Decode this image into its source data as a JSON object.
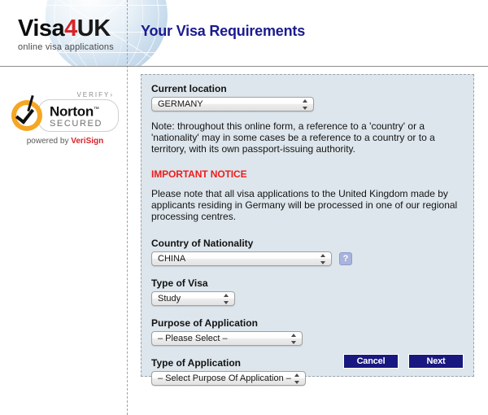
{
  "header": {
    "logo": {
      "part1": "Visa",
      "part2": "4",
      "part3": "UK",
      "tagline": "online visa applications"
    },
    "title": "Your Visa Requirements"
  },
  "security_badge": {
    "verify": "VERIFY›",
    "norton": "Norton",
    "trademark": "™",
    "secured": "SECURED",
    "powered_prefix": "powered by ",
    "powered_brand": "VeriSign"
  },
  "form": {
    "current_location": {
      "label": "Current location",
      "value": "GERMANY"
    },
    "note": "Note: throughout this online form, a reference to a 'country' or a 'nationality' may in some cases be a reference to a country or to a territory, with its own passport-issuing authority.",
    "important_notice": {
      "title": "IMPORTANT NOTICE",
      "body": "Please note that all visa applications to the United Kingdom made by applicants residing in Germany will be processed in one of our regional processing centres."
    },
    "country_of_nationality": {
      "label": "Country of Nationality",
      "value": "CHINA",
      "help": "?"
    },
    "type_of_visa": {
      "label": "Type of Visa",
      "value": "Study"
    },
    "purpose_of_application": {
      "label": "Purpose of Application",
      "value": "– Please Select –"
    },
    "type_of_application": {
      "label": "Type of Application",
      "value": "– Select Purpose Of Application –"
    },
    "buttons": {
      "cancel": "Cancel",
      "next": "Next"
    }
  },
  "colors": {
    "title_blue": "#1b1b8f",
    "accent_red": "#d8232a",
    "notice_red": "#ee1c1c",
    "panel_bg": "#dde6ec",
    "button_navy": "#181880",
    "norton_orange": "#f5a623"
  }
}
